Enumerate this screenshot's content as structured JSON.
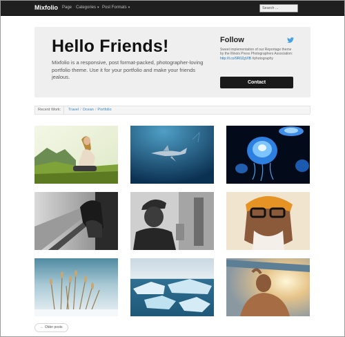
{
  "navbar": {
    "brand": "Mixfolio",
    "items": [
      {
        "label": "Page",
        "has_caret": false
      },
      {
        "label": "Categories",
        "has_caret": true
      },
      {
        "label": "Post Formats",
        "has_caret": true
      }
    ],
    "search_placeholder": "Search ..."
  },
  "hero": {
    "title": "Hello Friends!",
    "text": "Mixfolio is a responsive, post format-packed, photographer-loving portfolio theme. Use it for your portfolio and make your friends jealous."
  },
  "follow": {
    "title": "Follow",
    "icon": "twitter-bird-icon",
    "text_before": "Sweet implementation of our Reportage theme by the Illinois Press Photographers Association: ",
    "link": "http://t.co/9R0ZgVIB",
    "text_after": " #photography",
    "contact_label": "Contact"
  },
  "recent_work": {
    "label": "Recent Work:",
    "links": [
      "Travel",
      "Ocean",
      "Portfolio"
    ],
    "separator": "/"
  },
  "gallery": [
    {
      "name": "woman-on-hill-photo"
    },
    {
      "name": "shark-underwater-photo"
    },
    {
      "name": "jellyfish-photo"
    },
    {
      "name": "train-window-photo"
    },
    {
      "name": "man-in-cap-photo"
    },
    {
      "name": "old-man-glasses-photo"
    },
    {
      "name": "frosted-grass-photo"
    },
    {
      "name": "icebergs-photo"
    },
    {
      "name": "surfer-sunset-photo"
    }
  ],
  "pagination": {
    "older_label": "← Older posts"
  },
  "colors": {
    "navbar_bg": "#1f1f1f",
    "hero_bg": "#efefef",
    "link": "#3a86c8",
    "button_bg": "#1a1a1a"
  }
}
